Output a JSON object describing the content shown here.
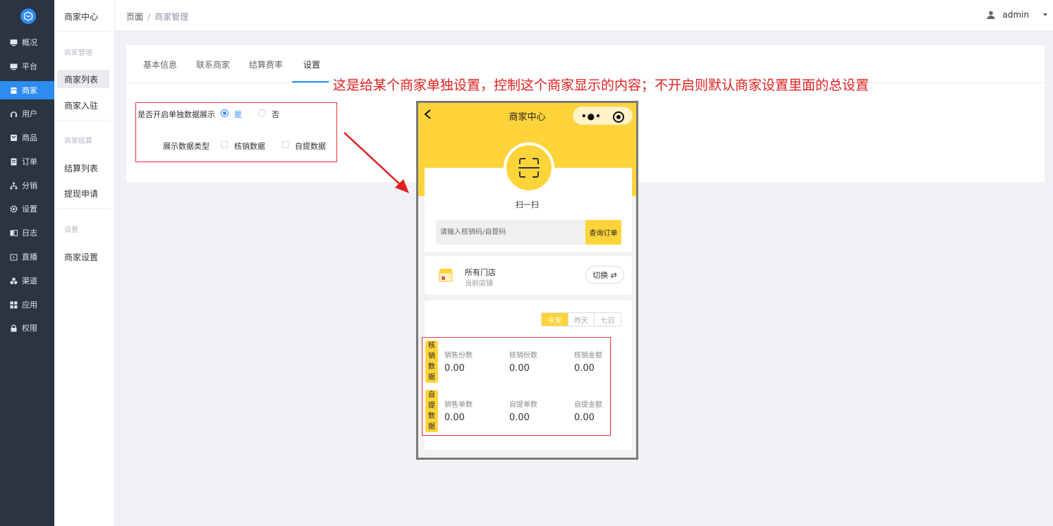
{
  "sidebar": {
    "items": [
      {
        "label": "概况",
        "icon": "dashboard-icon"
      },
      {
        "label": "平台",
        "icon": "monitor-icon"
      },
      {
        "label": "商家",
        "icon": "store-icon"
      },
      {
        "label": "用户",
        "icon": "user-icon"
      },
      {
        "label": "商品",
        "icon": "goods-icon"
      },
      {
        "label": "订单",
        "icon": "order-icon"
      },
      {
        "label": "分销",
        "icon": "distribution-icon"
      },
      {
        "label": "设置",
        "icon": "gear-icon"
      },
      {
        "label": "日志",
        "icon": "log-icon"
      },
      {
        "label": "直播",
        "icon": "live-icon"
      },
      {
        "label": "渠道",
        "icon": "channel-icon"
      },
      {
        "label": "应用",
        "icon": "apps-icon"
      },
      {
        "label": "权限",
        "icon": "lock-icon"
      }
    ],
    "active": "商家"
  },
  "submenu": {
    "title": "商家中心",
    "group1": "商家管理",
    "item_list": "商家列表",
    "item_join": "商家入驻",
    "group2": "商家结算",
    "item_settle": "结算列表",
    "item_withdraw": "提现申请",
    "group3": "设置",
    "item_settings": "商家设置"
  },
  "header": {
    "crumb_root": "页面",
    "crumb_sep": "/",
    "crumb_current": "商家管理",
    "user": "admin"
  },
  "tabs": [
    "基本信息",
    "联系商家",
    "结算费率",
    "设置"
  ],
  "active_tab": "设置",
  "form": {
    "switch_label": "是否开启单独数据展示",
    "yes": "是",
    "no": "否",
    "switch_value": "是",
    "type_label": "展示数据类型",
    "opt1": "核销数据",
    "opt2": "自提数据"
  },
  "annotation": "这是给某个商家单独设置，控制这个商家显示的内容；不开启则默认商家设置里面的总设置",
  "phone": {
    "title": "商家中心",
    "scan_label": "扫一扫",
    "search_placeholder": "请输入核销码/自提码",
    "search_button": "查询订单",
    "store_name": "所有门店",
    "store_sub": "当前店铺",
    "switch_label": "切换 ⇄",
    "segments": [
      "今天",
      "昨天",
      "七日"
    ],
    "active_segment": "今天",
    "tag1": "核销数据",
    "tag2": "自提数据",
    "row1": [
      {
        "label": "销售份数",
        "value": "0.00"
      },
      {
        "label": "核销份数",
        "value": "0.00"
      },
      {
        "label": "核销金额",
        "value": "0.00"
      }
    ],
    "row2": [
      {
        "label": "销售单数",
        "value": "0.00"
      },
      {
        "label": "自提单数",
        "value": "0.00"
      },
      {
        "label": "自提金额",
        "value": "0.00"
      }
    ]
  },
  "colors": {
    "accent": "#2d8cf0",
    "sidebar_bg": "#2b3441",
    "phone_yellow": "#ffd43a",
    "annotation_red": "#e02020"
  }
}
